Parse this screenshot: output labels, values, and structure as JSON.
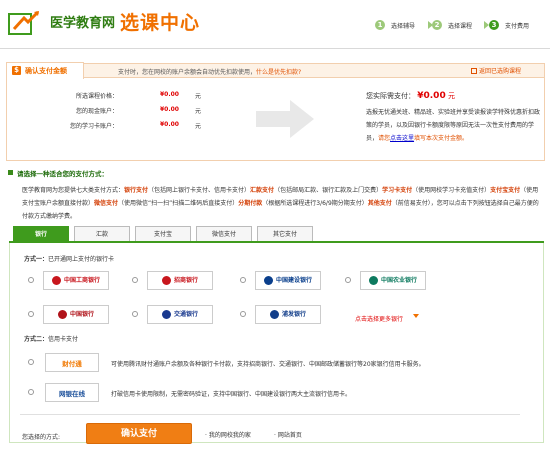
{
  "header": {
    "site_name": "医学教育网",
    "page_title": "选课中心",
    "steps": [
      {
        "num": "1",
        "label": "选择辅导",
        "color": "#9dc97a"
      },
      {
        "num": "2",
        "label": "选择课程",
        "color": "#9dc97a"
      },
      {
        "num": "3",
        "label": "支付费用",
        "color": "#3f9b1d"
      }
    ]
  },
  "confirm_bar": {
    "tab_label": "确认支付金额",
    "tip": "支付时，您在网校的账户余额会自动优先扣款使用，",
    "tip_link": "什么是优先扣款?",
    "back_link": "返回已选购课程"
  },
  "balances": [
    {
      "label": "所选课程价格：",
      "value": "¥0.00",
      "unit": "元"
    },
    {
      "label": "您的现金账户：",
      "value": "¥0.00",
      "unit": "元"
    },
    {
      "label": "您的学习卡账户：",
      "value": "¥0.00",
      "unit": "元"
    }
  ],
  "payment_due": {
    "label": "您实际需支付：",
    "amount": "¥0.00",
    "unit": "元",
    "desc": "选报无忧通关班、精品班、实验班并享受读报读学特殊优惠折扣政策的学员，以及因银行卡额度限等原因无法一次性支付费用的学员，",
    "desc_hl": "请您",
    "desc_link": "点击这里",
    "desc_tail": "填写本次支付金额。"
  },
  "method": {
    "title": "请选择一种适合您的支付方式：",
    "intro_a": "医学教育网为您提供七大类支付方式：",
    "m1": "银行支付",
    "m1_desc": "（包括网上银行卡支付、信用卡支付）",
    "m2": "汇款支付",
    "m2_desc": "（包括邮局汇款、银行汇款及上门交费）",
    "m3": "学习卡支付",
    "m3_desc": "（使用网校学习卡充值支付）",
    "m4": "支付宝支付",
    "m4_desc": "（使用支付宝账户余额直接付款）",
    "m5": "微信支付",
    "m5_desc": "（使用微信“扫一扫”扫描二维码后直接支付）",
    "m6": "分期付款",
    "m6_desc": "（根据所选课程进行3/6/9期分期支付）",
    "m7": "其他支付",
    "m7_desc": "（前信易支付），您可以点击下列按钮选择自己最方便的付款方式缴纳学费。"
  },
  "tabs": [
    "银行",
    "汇款",
    "支付宝",
    "微信支付",
    "其它支付"
  ],
  "bank_section": {
    "mode1_label": "方式一：",
    "mode1_desc": "已开通网上支付的银行卡",
    "banks": [
      {
        "name": "中国工商银行",
        "color": "#c8161d"
      },
      {
        "name": "招商银行",
        "color": "#c8161d"
      },
      {
        "name": "中国建设银行",
        "color": "#0a3f8c"
      },
      {
        "name": "中国农业银行",
        "color": "#0d7a5f"
      },
      {
        "name": "中国银行",
        "color": "#b0131a"
      },
      {
        "name": "交通银行",
        "color": "#1a3a8f"
      },
      {
        "name": "浦发银行",
        "color": "#123e8a"
      }
    ],
    "more_banks": "点击选择更多银行",
    "mode2_label": "方式二：",
    "mode2_desc": "信用卡支付",
    "cards": [
      {
        "logo": "财付通",
        "color": "#f07800",
        "desc": "可使用腾讯财付通账户余额及各种银行卡付款，支持招商银行、交通银行、中国邮政储蓄银行等20家银行信用卡服务。"
      },
      {
        "logo": "网银在线",
        "color": "#1a4f9a",
        "desc": "打破信用卡使用限制，无需密码验证，支持中国银行、中国建设银行两大主流银行信用卡。"
      }
    ]
  },
  "footer": {
    "chosen_label": "您选择的方式:",
    "confirm_label": "确认支付",
    "link_account": "· 我的网校我的家",
    "link_home": "· 网站首页"
  }
}
